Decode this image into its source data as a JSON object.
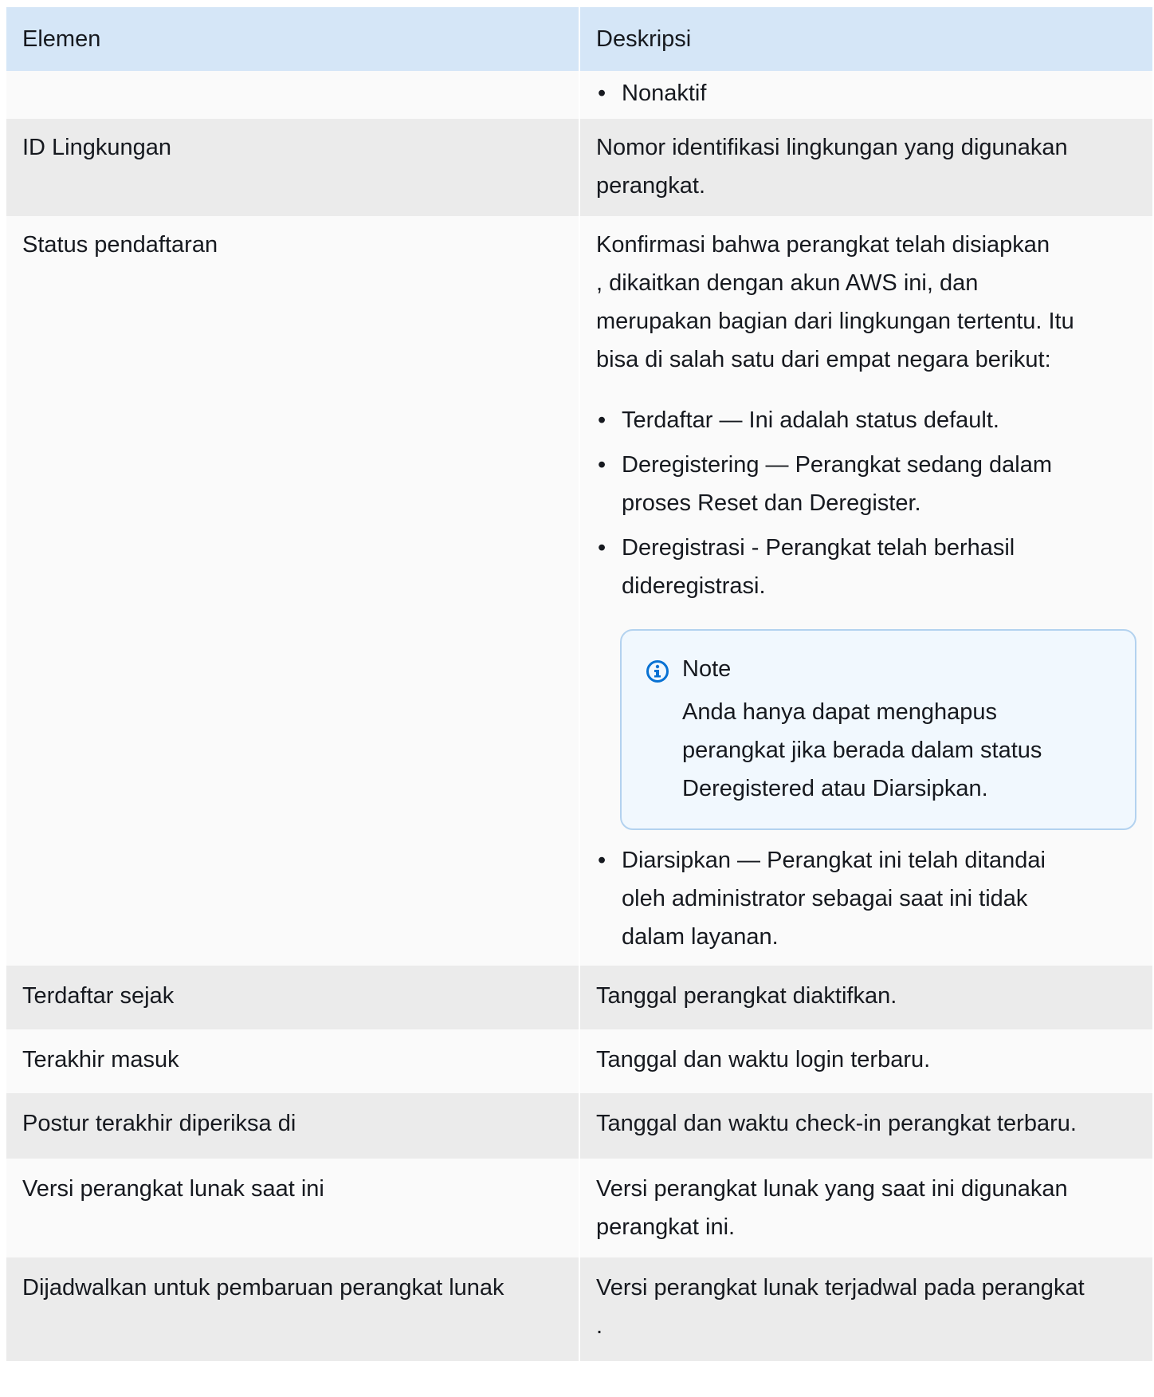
{
  "table": {
    "headers": [
      "Elemen",
      "Deskripsi"
    ],
    "row0": {
      "bullet": "Nonaktif"
    },
    "row1": {
      "element": "ID Lingkungan",
      "description": "Nomor identifikasi lingkungan yang digunakan perangkat."
    },
    "row2": {
      "element": "Status pendaftaran",
      "intro_lines": [
        "Konfirmasi bahwa perangkat telah disiapkan",
        ", dikaitkan dengan akun AWS ini, dan",
        "merupakan bagian dari lingkungan tertentu. Itu",
        "bisa di salah satu dari empat negara berikut:"
      ],
      "bullets": [
        [
          "Terdaftar — Ini adalah status default."
        ],
        [
          "Deregistering — Perangkat sedang dalam",
          "proses Reset dan Deregister."
        ],
        [
          "Deregistrasi - Perangkat telah berhasil",
          "dideregistrasi."
        ]
      ],
      "note": {
        "title": "Note",
        "lines": [
          "Anda hanya dapat menghapus",
          "perangkat jika berada dalam status",
          "Deregistered atau Diarsipkan."
        ]
      },
      "last_bullet": [
        "Diarsipkan — Perangkat ini telah ditandai",
        "oleh administrator sebagai saat ini tidak",
        "dalam layanan."
      ]
    },
    "row3": {
      "element": "Terdaftar sejak",
      "description": "Tanggal perangkat diaktifkan."
    },
    "row4": {
      "element": "Terakhir masuk",
      "description": "Tanggal dan waktu login terbaru."
    },
    "row5": {
      "element": "Postur terakhir diperiksa di",
      "description": "Tanggal dan waktu check-in perangkat terbaru."
    },
    "row6": {
      "element": "Versi perangkat lunak saat ini",
      "description_lines": [
        "Versi perangkat lunak yang saat ini digunakan",
        "perangkat ini."
      ]
    },
    "row7": {
      "element": "Dijadwalkan untuk pembaruan perangkat lunak",
      "description_lines": [
        "Versi perangkat lunak terjadwal pada perangkat",
        "."
      ]
    }
  },
  "icons": {
    "note_icon": "info-circle-icon",
    "accent": "#0972d3"
  }
}
